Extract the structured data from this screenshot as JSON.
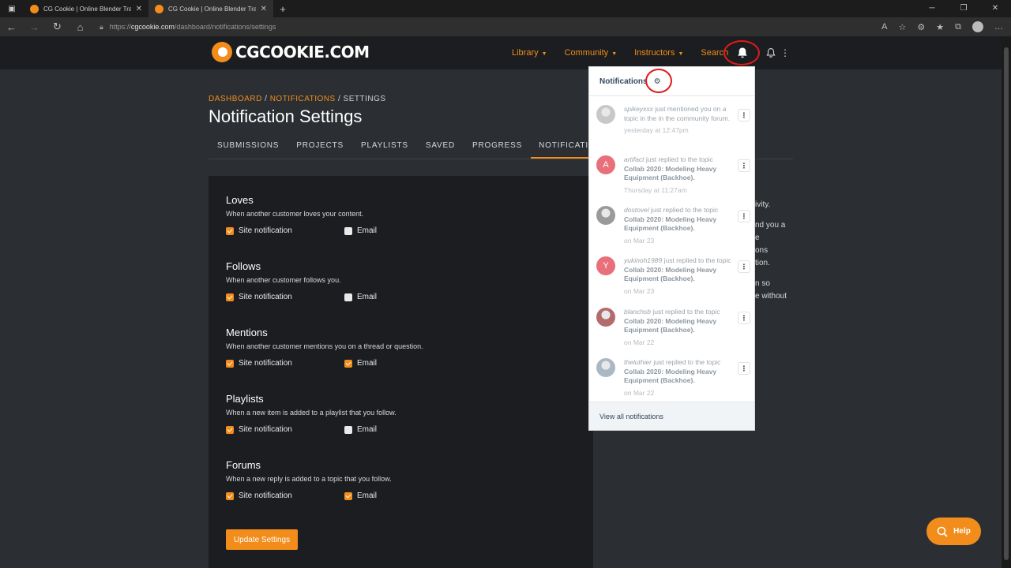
{
  "browser": {
    "tabs": [
      {
        "title": "CG Cookie | Online Blender Trai",
        "active": false
      },
      {
        "title": "CG Cookie | Online Blender Trai",
        "active": true
      }
    ],
    "url_prefix": "https://",
    "url_host": "cgcookie.com",
    "url_path": "/dashboard/notifications/settings"
  },
  "header": {
    "logo_text": "CGCOOKIE.COM",
    "nav": [
      {
        "label": "Library"
      },
      {
        "label": "Community"
      },
      {
        "label": "Instructors"
      },
      {
        "label": "Search"
      }
    ]
  },
  "breadcrumb": {
    "items": [
      "DASHBOARD",
      "NOTIFICATIONS",
      "SETTINGS"
    ],
    "separator": " / "
  },
  "page_title": "Notification Settings",
  "subtabs": [
    "SUBMISSIONS",
    "PROJECTS",
    "PLAYLISTS",
    "SAVED",
    "PROGRESS",
    "NOTIFICATIONS"
  ],
  "active_subtab": "NOTIFICATIONS",
  "settings": {
    "site_label": "Site notification",
    "email_label": "Email",
    "update_label": "Update Settings",
    "groups": [
      {
        "title": "Loves",
        "desc": "When another customer loves your content.",
        "site": true,
        "email": false
      },
      {
        "title": "Follows",
        "desc": "When another customer follows you.",
        "site": true,
        "email": false
      },
      {
        "title": "Mentions",
        "desc": "When another customer mentions you on a thread or question.",
        "site": true,
        "email": true
      },
      {
        "title": "Playlists",
        "desc": "When a new item is added to a playlist that you follow.",
        "site": true,
        "email": false
      },
      {
        "title": "Forums",
        "desc": "When a new reply is added to a topic that you follow.",
        "site": true,
        "email": true
      }
    ]
  },
  "side_text": [
    [
      "ivity."
    ],
    [
      "nd you a",
      "e",
      "ons",
      "tion."
    ],
    [
      "n so",
      "e without"
    ]
  ],
  "notifications": {
    "title": "Notifications",
    "footer": "View all notifications",
    "items": [
      {
        "user": "spikeyxxx",
        "action": " just mentioned you on a topic in the in the community forum.",
        "topic": "",
        "time": "yesterday at 12:47pm",
        "avatar": "photo",
        "color": "#c8c8c8"
      },
      {
        "user": "artifact",
        "action": " just replied to the topic ",
        "topic": "Collab 2020: Modeling Heavy Equipment (Backhoe).",
        "time": "Thursday at 11:27am",
        "avatar": "A",
        "color": "#e8707a"
      },
      {
        "user": "dostovel",
        "action": " just replied to the topic ",
        "topic": "Collab 2020: Modeling Heavy Equipment (Backhoe).",
        "time": "on Mar 23",
        "avatar": "photo",
        "color": "#9a9a9a"
      },
      {
        "user": "yukinoh1989",
        "action": " just replied to the topic ",
        "topic": "Collab 2020: Modeling Heavy Equipment (Backhoe).",
        "time": "on Mar 23",
        "avatar": "Y",
        "color": "#e8707a"
      },
      {
        "user": "blanchsb",
        "action": " just replied to the topic ",
        "topic": "Collab 2020: Modeling Heavy Equipment (Backhoe).",
        "time": "on Mar 22",
        "avatar": "photo",
        "color": "#b46b6b"
      },
      {
        "user": "theluthier",
        "action": " just replied to the topic ",
        "topic": "Collab 2020: Modeling Heavy Equipment (Backhoe).",
        "time": "on Mar 22",
        "avatar": "photo",
        "color": "#aab8c4"
      }
    ]
  },
  "help_label": "Help",
  "colors": {
    "accent": "#f28c1a",
    "highlight_ring": "#e01b1b",
    "panel_title": "#34495e"
  }
}
